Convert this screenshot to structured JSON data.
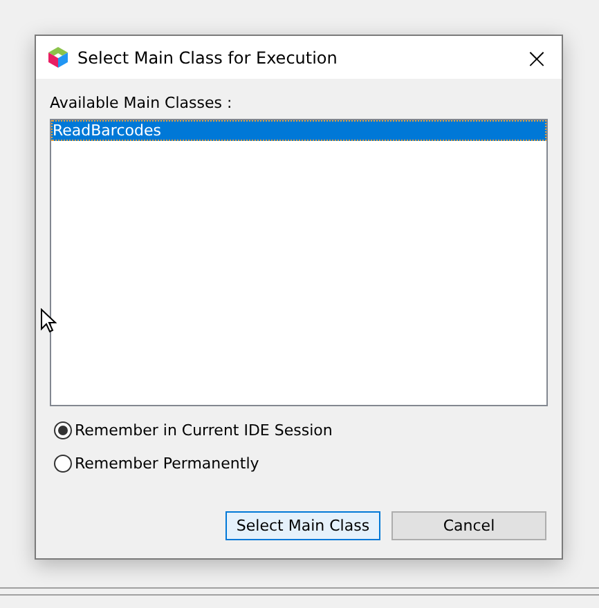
{
  "window": {
    "title": "Select Main Class for Execution",
    "close": "×"
  },
  "list": {
    "label": "Available Main Classes :",
    "items": [
      {
        "text": "ReadBarcodes",
        "selected": true
      }
    ]
  },
  "options": [
    {
      "label": "Remember in Current IDE Session",
      "selected": true
    },
    {
      "label": "Remember Permanently",
      "selected": false
    }
  ],
  "buttons": [
    {
      "label": "Select Main Class",
      "kind": "default"
    },
    {
      "label": "Cancel",
      "kind": "normal"
    }
  ]
}
